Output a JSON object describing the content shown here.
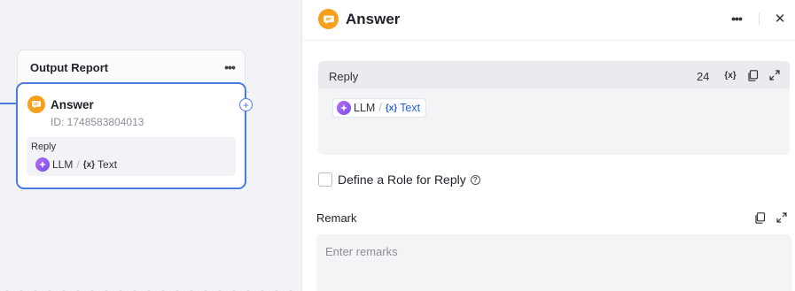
{
  "canvas": {
    "group": {
      "title": "Output Report",
      "more_icon": "ellipsis-icon"
    },
    "node": {
      "title": "Answer",
      "id_text": "ID: 1748583804013",
      "icon": "chat-bubble-icon",
      "port_icon": "plus-circle-icon",
      "reply_label": "Reply",
      "chip": {
        "source": "LLM",
        "separator": "/",
        "var_glyph": "{x}",
        "variable": "Text"
      }
    }
  },
  "panel": {
    "title": "Answer",
    "icon": "chat-bubble-icon",
    "more_icon": "ellipsis-icon",
    "close_glyph": "✕",
    "reply": {
      "label": "Reply",
      "count": "24",
      "var_glyph": "{x}",
      "chip": {
        "source": "LLM",
        "separator": "/",
        "var_glyph": "{x}",
        "variable": "Text"
      }
    },
    "role_checkbox": {
      "label": "Define a Role for Reply",
      "checked": false,
      "help_glyph": "?"
    },
    "remark": {
      "label": "Remark",
      "placeholder": "Enter remarks",
      "value": ""
    }
  },
  "colors": {
    "accent": "#4a7ce0",
    "node_icon": "#f7a01b",
    "llm_gradient_start": "#b56ff5",
    "llm_gradient_end": "#7a4de8",
    "variable_blue": "#2b5fd9"
  }
}
